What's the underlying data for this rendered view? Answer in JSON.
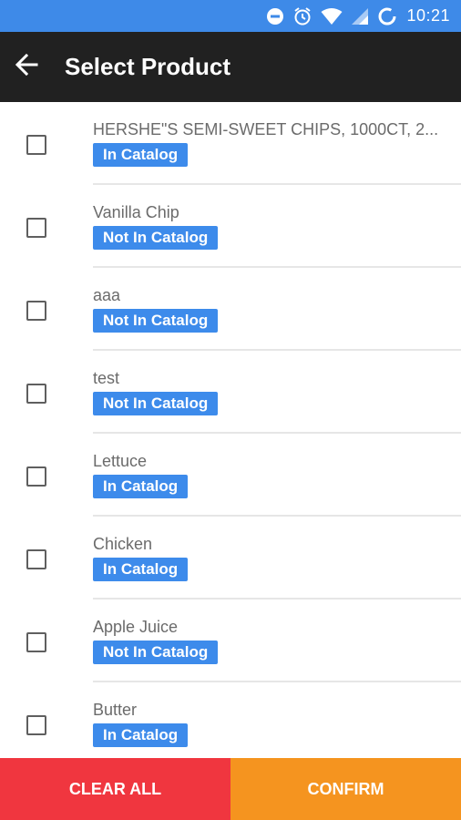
{
  "status_bar": {
    "time": "10:21",
    "icons": [
      "do-not-disturb-icon",
      "alarm-icon",
      "wifi-icon",
      "signal-icon",
      "battery-icon"
    ]
  },
  "app_bar": {
    "back_icon": "arrow-back-icon",
    "title": "Select Product"
  },
  "products": [
    {
      "name": "HERSHE\"S SEMI-SWEET CHIPS, 1000CT, 2...",
      "status": "In Catalog",
      "checked": false
    },
    {
      "name": "Vanilla Chip",
      "status": "Not In Catalog",
      "checked": false
    },
    {
      "name": "aaa",
      "status": "Not In Catalog",
      "checked": false
    },
    {
      "name": "test",
      "status": "Not In Catalog",
      "checked": false
    },
    {
      "name": "Lettuce",
      "status": "In Catalog",
      "checked": false
    },
    {
      "name": "Chicken",
      "status": "In Catalog",
      "checked": false
    },
    {
      "name": "Apple Juice",
      "status": "Not In Catalog",
      "checked": false
    },
    {
      "name": "Butter",
      "status": "In Catalog",
      "checked": false
    }
  ],
  "buttons": {
    "clear_all": "CLEAR ALL",
    "confirm": "CONFIRM"
  },
  "colors": {
    "status_bar": "#3e8ae8",
    "app_bar": "#212121",
    "badge": "#3d8beb",
    "clear_button": "#f0363f",
    "confirm_button": "#f5941f"
  }
}
